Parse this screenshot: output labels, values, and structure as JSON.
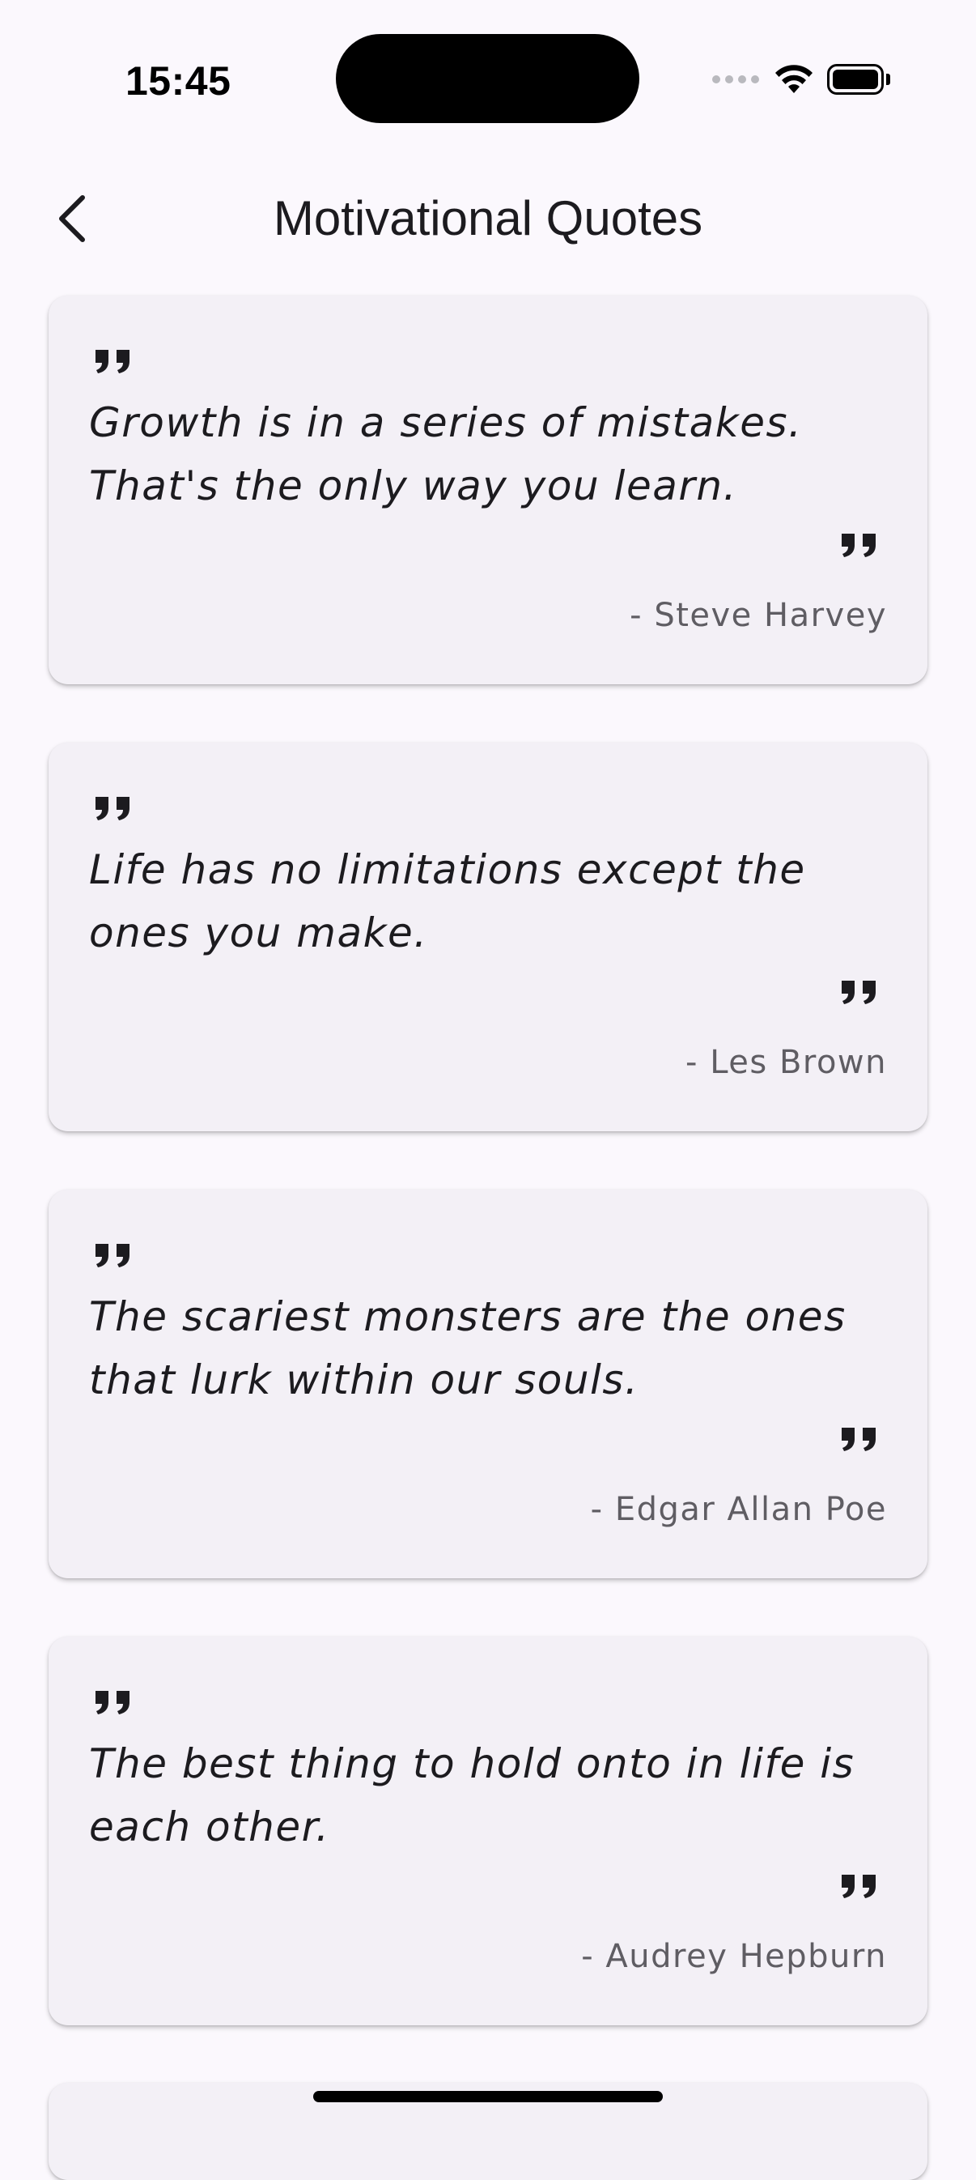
{
  "status_bar": {
    "time": "15:45"
  },
  "app_bar": {
    "back_icon": "chevron-left-icon",
    "title": "Motivational Quotes"
  },
  "quotes": [
    {
      "text": "Growth is in a series of mistakes. That's the only way you learn.",
      "author": "- Steve Harvey"
    },
    {
      "text": "Life has no limitations except the ones you make.",
      "author": "- Les Brown"
    },
    {
      "text": "The scariest monsters are the ones that lurk within our souls.",
      "author": "- Edgar Allan Poe"
    },
    {
      "text": "The best thing to hold onto in life is each other.",
      "author": "- Audrey Hepburn"
    }
  ],
  "colors": {
    "background": "#FBF8FD",
    "card": "#F3F0F6",
    "text": "#1C1B1F",
    "author_text": "#5F5D63"
  }
}
